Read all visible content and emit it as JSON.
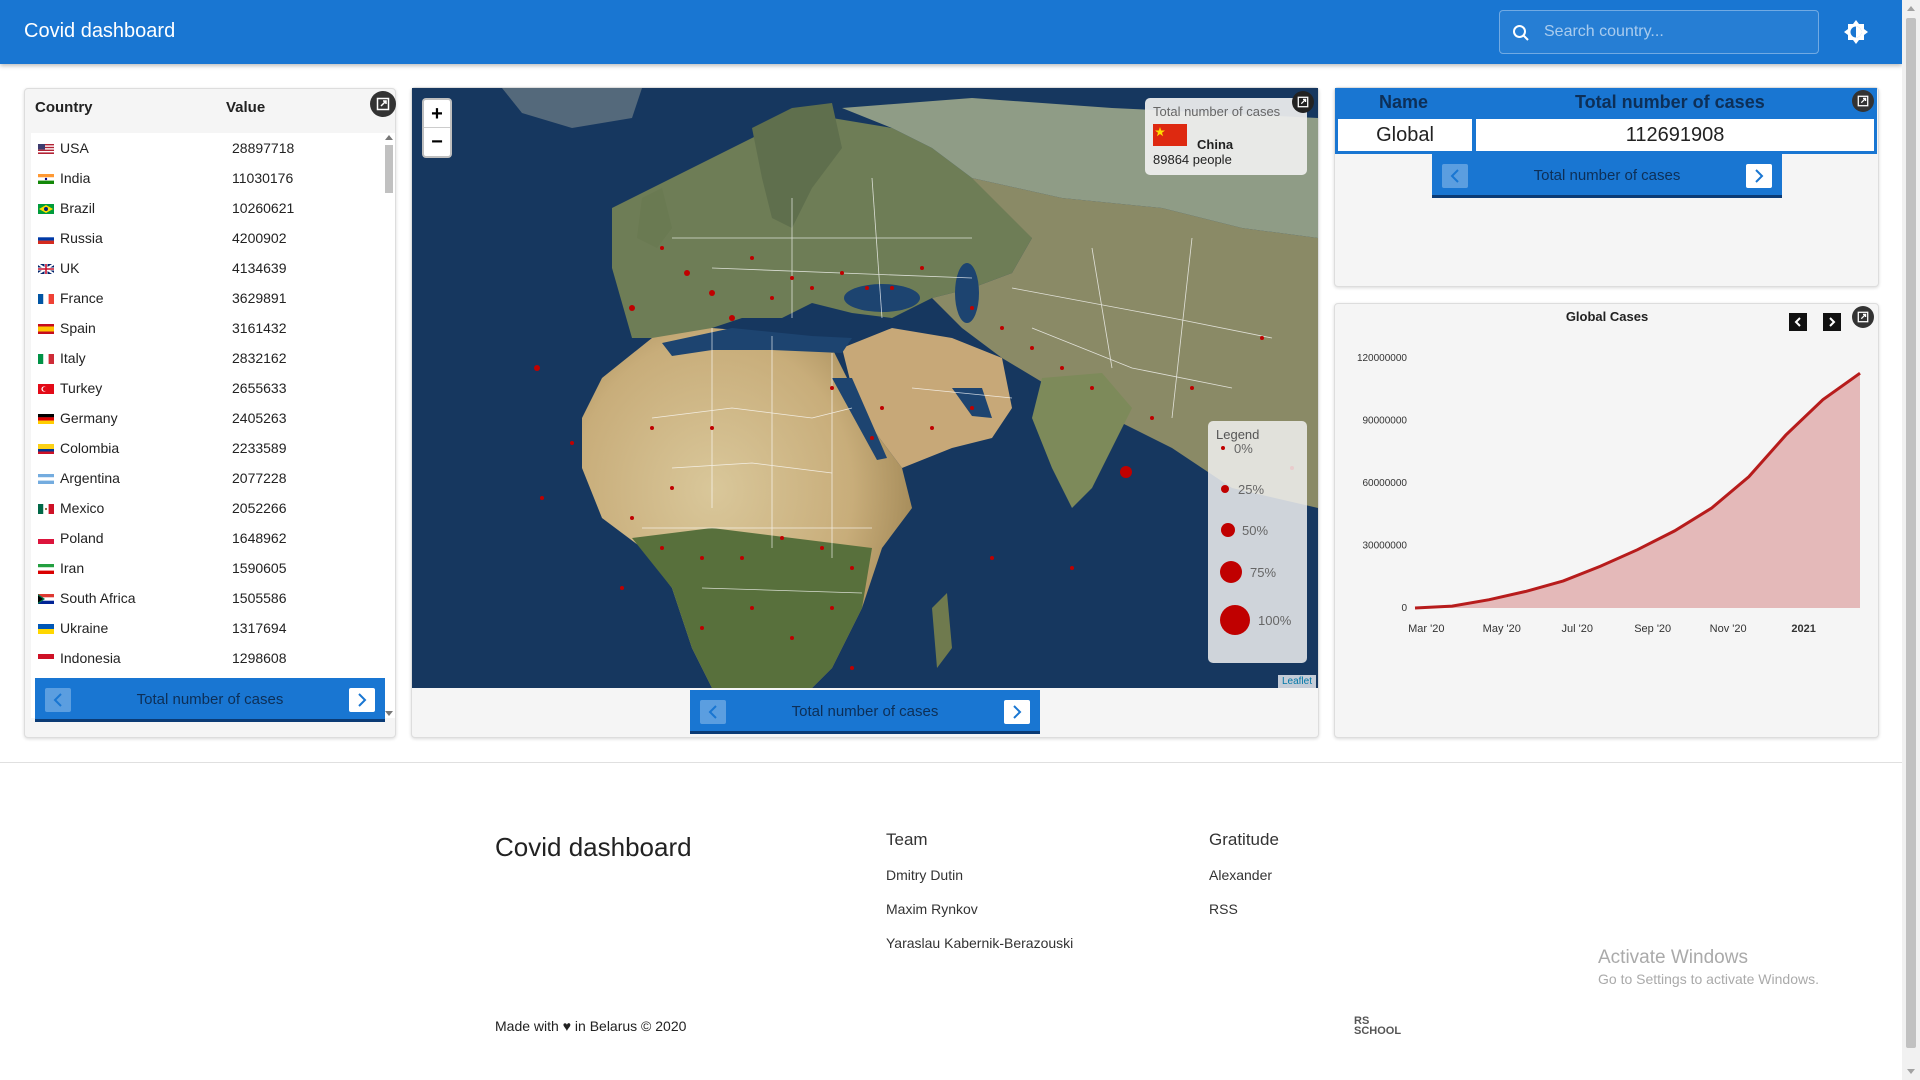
{
  "header": {
    "title": "Covid dashboard",
    "search_placeholder": "Search country..."
  },
  "country_list": {
    "col_country": "Country",
    "col_value": "Value",
    "rows": [
      {
        "country": "USA",
        "value": "28897718",
        "flag": "us"
      },
      {
        "country": "India",
        "value": "11030176",
        "flag": "in"
      },
      {
        "country": "Brazil",
        "value": "10260621",
        "flag": "br"
      },
      {
        "country": "Russia",
        "value": "4200902",
        "flag": "ru"
      },
      {
        "country": "UK",
        "value": "4134639",
        "flag": "uk"
      },
      {
        "country": "France",
        "value": "3629891",
        "flag": "fr"
      },
      {
        "country": "Spain",
        "value": "3161432",
        "flag": "es"
      },
      {
        "country": "Italy",
        "value": "2832162",
        "flag": "it"
      },
      {
        "country": "Turkey",
        "value": "2655633",
        "flag": "tr"
      },
      {
        "country": "Germany",
        "value": "2405263",
        "flag": "de"
      },
      {
        "country": "Colombia",
        "value": "2233589",
        "flag": "co"
      },
      {
        "country": "Argentina",
        "value": "2077228",
        "flag": "ar"
      },
      {
        "country": "Mexico",
        "value": "2052266",
        "flag": "mx"
      },
      {
        "country": "Poland",
        "value": "1648962",
        "flag": "pl"
      },
      {
        "country": "Iran",
        "value": "1590605",
        "flag": "ir"
      },
      {
        "country": "South Africa",
        "value": "1505586",
        "flag": "za"
      },
      {
        "country": "Ukraine",
        "value": "1317694",
        "flag": "ua"
      },
      {
        "country": "Indonesia",
        "value": "1298608",
        "flag": "id"
      }
    ],
    "switcher_label": "Total number of cases"
  },
  "map": {
    "zoom_in": "+",
    "zoom_out": "−",
    "info_title": "Total number of cases",
    "info_country": "China",
    "info_people": "89864 people",
    "legend_title": "Legend",
    "legend_items": [
      "0%",
      "25%",
      "50%",
      "75%",
      "100%"
    ],
    "attribution": "Leaflet",
    "switcher_label": "Total number of cases"
  },
  "summary": {
    "col_name": "Name",
    "col_total": "Total number of cases",
    "name": "Global",
    "total": "112691908",
    "switcher_label": "Total number of cases"
  },
  "chart_data": {
    "type": "area",
    "title": "Global Cases",
    "xlabel": "",
    "ylabel": "",
    "x_ticks": [
      "Mar '20",
      "May '20",
      "Jul '20",
      "Sep '20",
      "Nov '20",
      "2021"
    ],
    "y_ticks": [
      "0",
      "30000000",
      "60000000",
      "90000000",
      "120000000"
    ],
    "ylim": [
      0,
      120000000
    ],
    "x": [
      0,
      1,
      2,
      3,
      4,
      5,
      6,
      7,
      8,
      9,
      10,
      11,
      12
    ],
    "series": [
      {
        "values": [
          0,
          900000,
          4000000,
          8000000,
          13000000,
          20000000,
          28000000,
          37000000,
          48000000,
          63000000,
          83000000,
          100000000,
          112691908
        ],
        "color": "#b71c1c"
      }
    ]
  },
  "footer": {
    "brand": "Covid dashboard",
    "team_title": "Team",
    "team": [
      "Dmitry Dutin",
      "Maxim Rynkov",
      "Yaraslau Kabernik-Berazouski"
    ],
    "gratitude_title": "Gratitude",
    "gratitude": [
      "Alexander",
      "RSS"
    ],
    "made_prefix": "Made with",
    "made_suffix": "in Belarus © 2020",
    "activate_title": "Activate Windows",
    "activate_sub": "Go to Settings to activate Windows.",
    "rs_logo": "RS SCHOOL"
  },
  "colors": {
    "primary": "#1976d2",
    "marker": "#c00000",
    "chart_line": "#b71c1c"
  }
}
